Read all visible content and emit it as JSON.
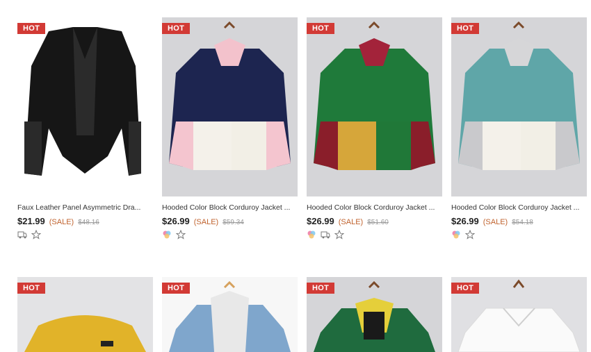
{
  "products": [
    {
      "badge": "HOT",
      "title": "Faux Leather Panel Asymmetric Dra...",
      "price": "$21.99",
      "sale": "(SALE)",
      "orig": "$48.16",
      "icons": [
        "truck-icon",
        "star-icon"
      ]
    },
    {
      "badge": "HOT",
      "title": "Hooded Color Block Corduroy Jacket ...",
      "price": "$26.99",
      "sale": "(SALE)",
      "orig": "$59.34",
      "icons": [
        "color-swatch-icon",
        "star-icon"
      ]
    },
    {
      "badge": "HOT",
      "title": "Hooded Color Block Corduroy Jacket ...",
      "price": "$26.99",
      "sale": "(SALE)",
      "orig": "$51.60",
      "icons": [
        "color-swatch-icon",
        "truck-icon",
        "star-icon"
      ]
    },
    {
      "badge": "HOT",
      "title": "Hooded Color Block Corduroy Jacket ...",
      "price": "$26.99",
      "sale": "(SALE)",
      "orig": "$54.18",
      "icons": [
        "color-swatch-icon",
        "star-icon"
      ]
    },
    {
      "badge": "HOT"
    },
    {
      "badge": "HOT"
    },
    {
      "badge": "HOT"
    },
    {
      "badge": "HOT"
    }
  ],
  "colors": {
    "badge": "#d23a35",
    "sale": "#c0622d"
  }
}
